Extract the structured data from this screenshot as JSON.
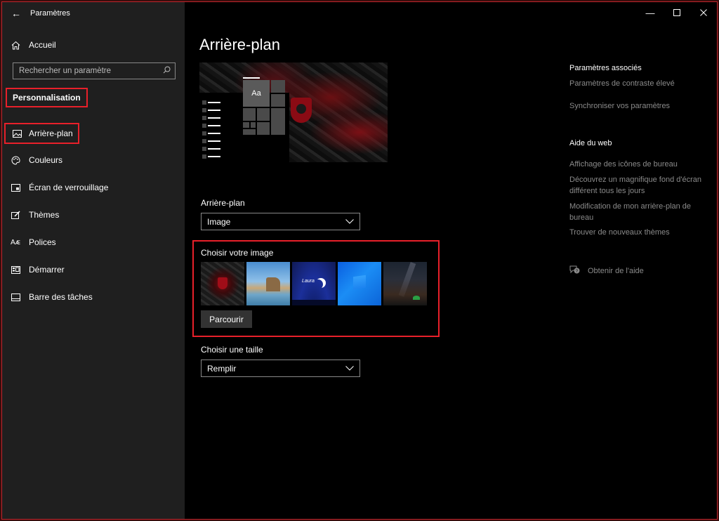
{
  "window": {
    "title": "Paramètres"
  },
  "sidebar": {
    "home_label": "Accueil",
    "search_placeholder": "Rechercher un paramètre",
    "section_title": "Personnalisation",
    "items": [
      {
        "label": "Arrière-plan",
        "icon": "image-icon",
        "active": true
      },
      {
        "label": "Couleurs",
        "icon": "palette-icon"
      },
      {
        "label": "Écran de verrouillage",
        "icon": "lock-screen-icon"
      },
      {
        "label": "Thèmes",
        "icon": "brush-icon"
      },
      {
        "label": "Polices",
        "icon": "font-icon"
      },
      {
        "label": "Démarrer",
        "icon": "start-menu-icon"
      },
      {
        "label": "Barre des tâches",
        "icon": "taskbar-icon"
      }
    ]
  },
  "main": {
    "title": "Arrière-plan",
    "preview": {
      "tile_text": "Aa"
    },
    "background_label": "Arrière-plan",
    "background_value": "Image",
    "choose_image_label": "Choisir votre image",
    "thumbnails_count": 5,
    "thumbnail_3_text": "Laura",
    "browse_label": "Parcourir",
    "fit_label": "Choisir une taille",
    "fit_value": "Remplir"
  },
  "related": {
    "heading": "Paramètres associés",
    "links": [
      "Paramètres de contraste élevé",
      "Synchroniser vos paramètres"
    ]
  },
  "web_help": {
    "heading": "Aide du web",
    "links": [
      "Affichage des icônes de bureau",
      "Découvrez un magnifique fond d'écran différent tous les jours",
      "Modification de mon arrière-plan de bureau",
      "Trouver de nouveaux thèmes"
    ]
  },
  "get_help": "Obtenir de l'aide",
  "colors": {
    "accent_highlight": "#e8202a",
    "sidebar_bg": "#1f1f1f",
    "main_bg": "#000000",
    "secondary_text": "#8a8a8a"
  }
}
